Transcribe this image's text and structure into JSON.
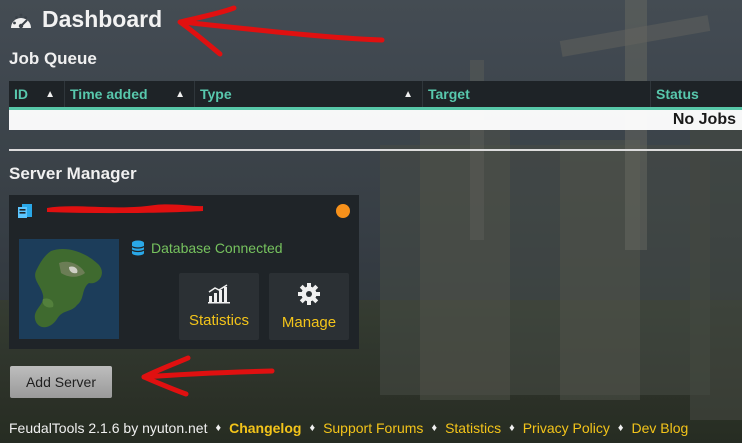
{
  "page": {
    "title": "Dashboard",
    "colors": {
      "accent": "#58c8ad",
      "link": "#f3c41a",
      "status_dot": "#f7911b",
      "success": "#76c25e",
      "annotation": "#e01010"
    }
  },
  "job_queue": {
    "title": "Job Queue",
    "columns": [
      {
        "label": "ID",
        "sortable": true
      },
      {
        "label": "Time added",
        "sortable": true
      },
      {
        "label": "Type",
        "sortable": true
      },
      {
        "label": "Target",
        "sortable": false
      },
      {
        "label": "Status",
        "sortable": false
      }
    ],
    "empty_text": "No Jobs"
  },
  "server_manager": {
    "title": "Server Manager",
    "server": {
      "name": "",
      "icons": {
        "server": "server-icon",
        "database": "database-icon",
        "statistics": "bar-chart-icon",
        "manage": "gear-icon"
      },
      "db_status": "Database Connected",
      "buttons": {
        "statistics": "Statistics",
        "manage": "Manage"
      }
    },
    "add_button": "Add Server"
  },
  "footer": {
    "version_text": "FeudalTools 2.1.6 by nyuton.net",
    "links": [
      {
        "label": "Changelog",
        "bold": true
      },
      {
        "label": "Support Forums",
        "bold": false
      },
      {
        "label": "Statistics",
        "bold": false
      },
      {
        "label": "Privacy Policy",
        "bold": false
      },
      {
        "label": "Dev Blog",
        "bold": false
      }
    ],
    "separator": "♦"
  }
}
